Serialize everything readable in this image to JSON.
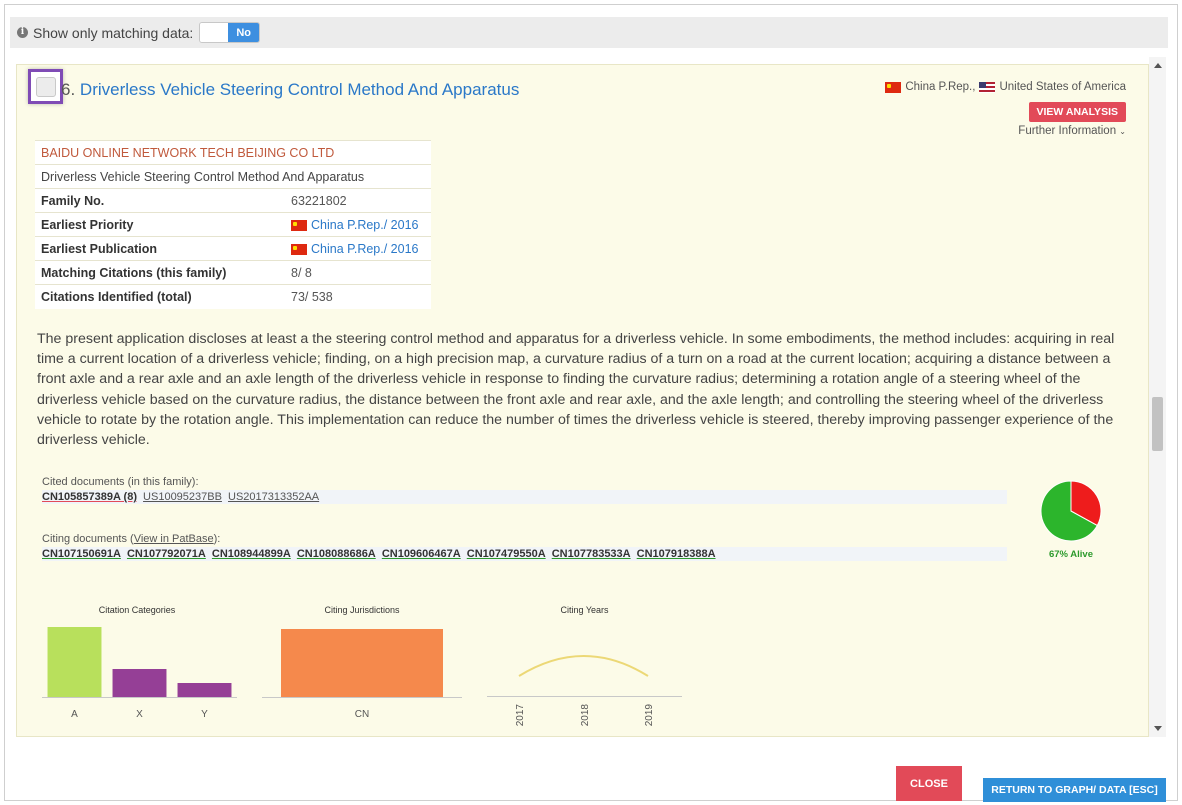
{
  "filter": {
    "label": "Show only matching data:",
    "toggle_value": "No"
  },
  "result": {
    "number": "6.",
    "title": "Driverless Vehicle Steering Control Method And Apparatus",
    "countries": [
      "China P.Rep.,",
      "United States of America"
    ],
    "view_analysis": "VIEW ANALYSIS",
    "further_info": "Further Information",
    "applicant": "BAIDU ONLINE NETWORK TECH BEIJING CO LTD",
    "subtitle": "Driverless Vehicle Steering Control Method And Apparatus",
    "fields": [
      {
        "label": "Family No.",
        "value": "63221802"
      },
      {
        "label": "Earliest Priority",
        "value": "China P.Rep./ 2016"
      },
      {
        "label": "Earliest Publication",
        "value": "China P.Rep./ 2016"
      },
      {
        "label": "Matching Citations (this family)",
        "value": "8/ 8"
      },
      {
        "label": "Citations Identified (total)",
        "value": "73/ 538"
      }
    ],
    "abstract": "The present application discloses at least a the steering control method and apparatus for a driverless vehicle. In some embodiments, the method includes: acquiring in real time a current location of a driverless vehicle; finding, on a high precision map, a curvature radius of a turn on a road at the current location; acquiring a distance between a front axle and a rear axle and an axle length of the driverless vehicle in response to finding the curvature radius; determining a rotation angle of a steering wheel of the driverless vehicle based on the curvature radius, the distance between the front axle and rear axle, and the axle length; and controlling the steering wheel of the driverless vehicle to rotate by the rotation angle. This implementation can reduce the number of times the driverless vehicle is steered, thereby improving passenger experience of the driverless vehicle.",
    "cited_label": "Cited documents (in this family):",
    "cited_docs": [
      "CN105857389A (8)",
      "US10095237BB",
      "US2017313352AA"
    ],
    "citing_label_prefix": "Citing documents (",
    "citing_link": "View in PatBase",
    "citing_label_suffix": "):",
    "citing_docs": [
      "CN107150691A",
      "CN107792071A",
      "CN108944899A",
      "CN108088686A",
      "CN109606467A",
      "CN107479550A",
      "CN107783533A",
      "CN107918388A"
    ]
  },
  "colors": {
    "accent_red": "#e24a58",
    "accent_blue": "#2f8fd8",
    "alive_green": "#2cb52c",
    "dead_red": "#ee1c1c",
    "bar_green": "#b8e05c",
    "bar_purple": "#953f96",
    "bar_orange": "#f5894c",
    "line_yellow": "#ecd876"
  },
  "chart_data": [
    {
      "type": "pie",
      "labels": [
        "Alive",
        "Dead"
      ],
      "values": [
        67,
        33
      ],
      "caption": "67% Alive"
    },
    {
      "type": "bar",
      "title": "Citation Categories",
      "categories": [
        "A",
        "X",
        "Y"
      ],
      "values": [
        5,
        2,
        1
      ],
      "ylim": [
        0,
        5
      ]
    },
    {
      "type": "bar",
      "title": "Citing Jurisdictions",
      "categories": [
        "CN"
      ],
      "values": [
        8
      ],
      "ylim": [
        0,
        8
      ]
    },
    {
      "type": "line",
      "title": "Citing Years",
      "x": [
        "2017",
        "2018",
        "2019"
      ],
      "values": [
        2,
        4,
        2
      ],
      "ylim": [
        0,
        6
      ]
    }
  ],
  "footer": {
    "close": "CLOSE",
    "return": "RETURN TO GRAPH/ DATA [ESC]"
  }
}
